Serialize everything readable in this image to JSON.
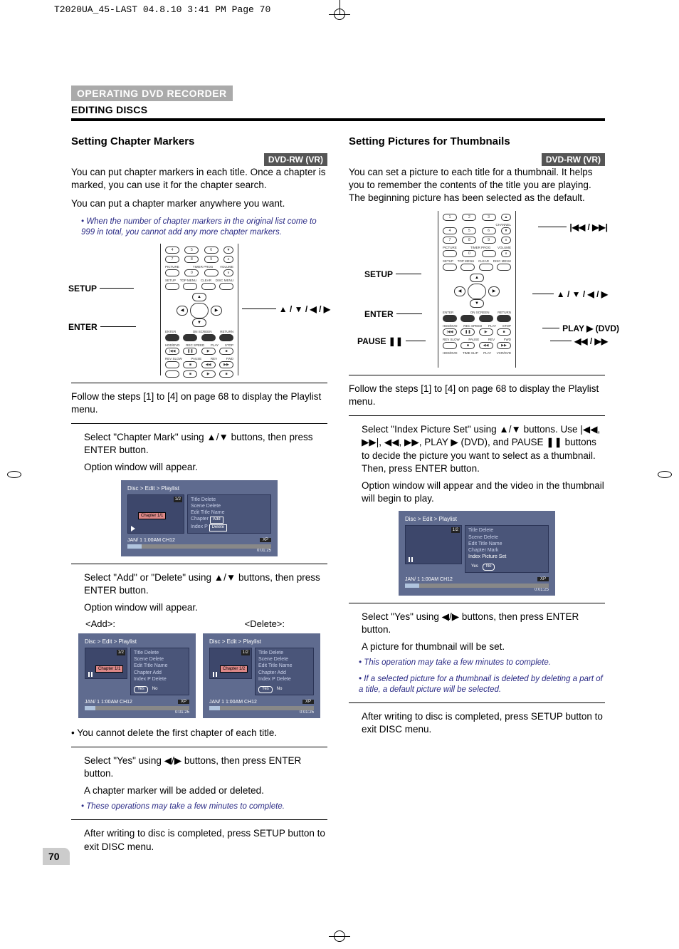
{
  "header_run": "T2020UA_45-LAST  04.8.10 3:41 PM  Page 70",
  "page_number": "70",
  "section_banner": "OPERATING DVD RECORDER",
  "section_sub": "EDITING DISCS",
  "left": {
    "title": "Setting Chapter Markers",
    "badge": "DVD-RW (VR)",
    "p1": "You can put chapter markers in each title. Once a chapter is marked, you can use it for the chapter search.",
    "p2": "You can put a chapter marker anywhere you want.",
    "note1": "• When the number of chapter markers in the original list come to 999 in total, you cannot add any more chapter markers.",
    "callout_setup": "SETUP",
    "callout_enter": "ENTER",
    "callout_arrows": "▲ / ▼ / ◀ / ▶",
    "step_follow": "Follow the steps [1] to [4] on page 68 to display the Playlist menu.",
    "step1a": "Select \"Chapter Mark\" using ▲/▼ buttons, then press ENTER button.",
    "step1b": "Option window will appear.",
    "step2a": "Select \"Add\" or \"Delete\" using ▲/▼ buttons, then press ENTER button.",
    "step2b": "Option window will appear.",
    "caption_add": "<Add>:",
    "caption_del": "<Delete>:",
    "bullet_cannot": "• You cannot delete the first chapter of each title.",
    "step3a": "Select \"Yes\" using ◀/▶ buttons, then press ENTER button.",
    "step3b": "A chapter marker will be added or deleted.",
    "note2": "• These operations may take a few minutes to complete.",
    "step4": "After writing to disc is completed, press SETUP button to exit DISC menu."
  },
  "right": {
    "title": "Setting Pictures for Thumbnails",
    "badge": "DVD-RW (VR)",
    "p1": "You can set a picture to each title for a thumbnail. It helps you to remember the contents of the title you are playing. The beginning picture has been selected as the default.",
    "callout_setup": "SETUP",
    "callout_enter": "ENTER",
    "callout_pause": "PAUSE ❚❚",
    "callout_arrows_top": "▲ / ▼ / ◀ / ▶",
    "callout_skip": "|◀◀ / ▶▶|",
    "callout_play": "PLAY ▶ (DVD)",
    "callout_rev": "◀◀ / ▶▶",
    "step_follow": "Follow the steps [1] to [4] on page 68 to display the Playlist menu.",
    "step1a": "Select \"Index Picture Set\" using ▲/▼ buttons. Use |◀◀, ▶▶|, ◀◀, ▶▶, PLAY ▶ (DVD), and PAUSE ❚❚ buttons to decide the picture you want to select as a thumbnail. Then, press ENTER button.",
    "step1b": "Option window will appear and the video in the thumbnail will begin to play.",
    "step2a": "Select \"Yes\" using ◀/▶ buttons, then press ENTER button.",
    "step2b": "A picture for thumbnail will be set.",
    "note1": "• This operation may take a few minutes to complete.",
    "note2": "• If a selected picture for a thumbnail is deleted by deleting a part of a title, a default picture will be selected.",
    "step3": "After writing to disc is completed, press SETUP button to exit DISC menu."
  },
  "screen": {
    "path": "Disc > Edit > Playlist",
    "menu_items": {
      "title_delete": "Title Delete",
      "scene_delete": "Scene Delete",
      "edit_title": "Edit Title Name",
      "chapter_label": "Chapter",
      "chapter_mark": "Chapter Mark",
      "index_p": "Index P",
      "index_picture": "Index Picture Set",
      "add": "Add",
      "delete": "Delete",
      "yes": "Yes",
      "no": "No"
    },
    "chapter_11": "Chapter 1/1",
    "chapter_12": "Chapter 1/2",
    "chapter_badge": "1/2",
    "foot": "JAN/ 1   1:00AM  CH12",
    "xp": "XP",
    "time": "0:01:25"
  }
}
